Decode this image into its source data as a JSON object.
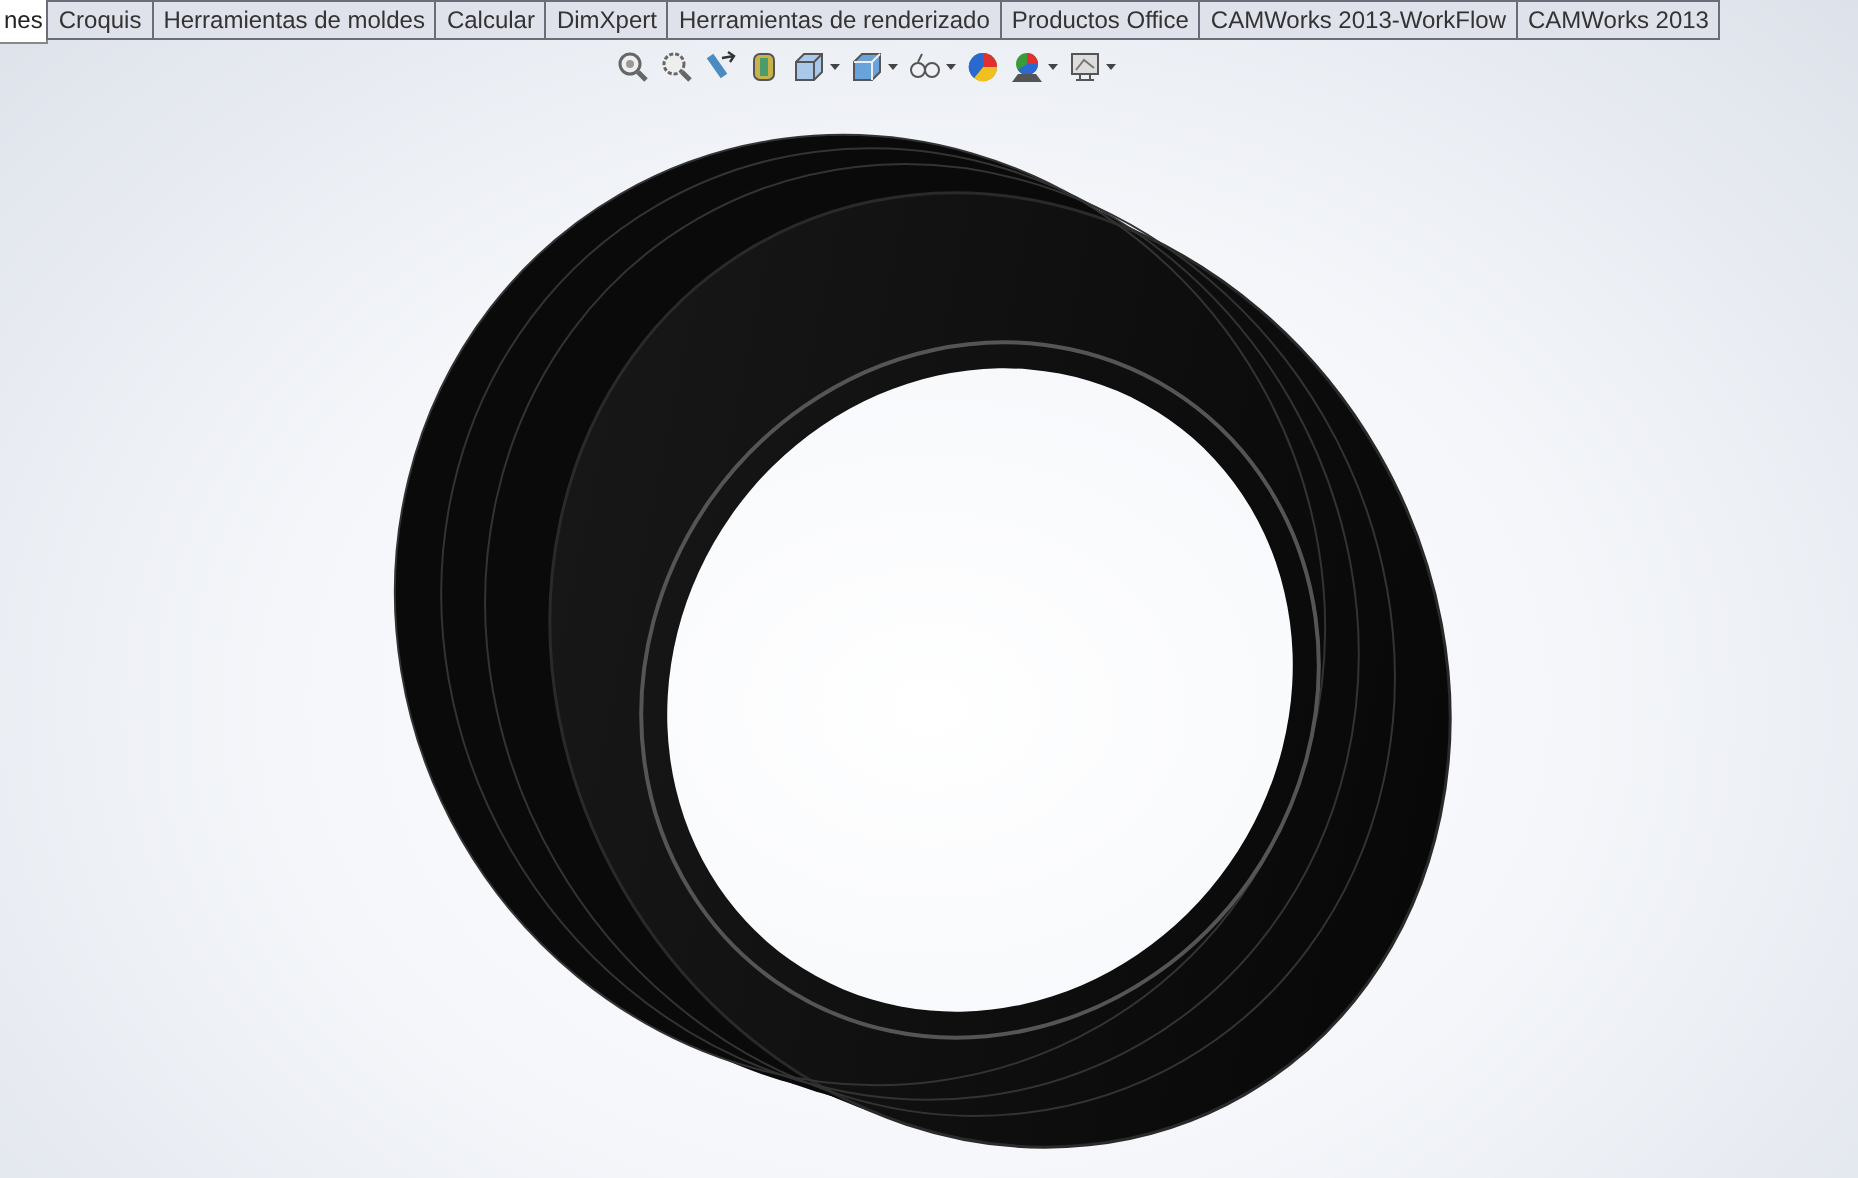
{
  "tabs": [
    {
      "label": "nes",
      "selected": true
    },
    {
      "label": "Croquis",
      "selected": false
    },
    {
      "label": "Herramientas de moldes",
      "selected": false
    },
    {
      "label": "Calcular",
      "selected": false
    },
    {
      "label": "DimXpert",
      "selected": false
    },
    {
      "label": "Herramientas de renderizado",
      "selected": false
    },
    {
      "label": "Productos Office",
      "selected": false
    },
    {
      "label": "CAMWorks 2013-WorkFlow",
      "selected": false
    },
    {
      "label": "CAMWorks 2013",
      "selected": false
    }
  ],
  "view_toolbar": [
    {
      "kind": "zoom-fit",
      "dropdown": false
    },
    {
      "kind": "zoom-area",
      "dropdown": false
    },
    {
      "kind": "previous-view",
      "dropdown": false
    },
    {
      "kind": "section-view",
      "dropdown": false
    },
    {
      "kind": "view-orientation",
      "dropdown": true
    },
    {
      "kind": "display-style",
      "dropdown": true
    },
    {
      "kind": "hide-show",
      "dropdown": true
    },
    {
      "kind": "appearance",
      "dropdown": false
    },
    {
      "kind": "scene",
      "dropdown": true
    },
    {
      "kind": "view-settings",
      "dropdown": true
    }
  ]
}
